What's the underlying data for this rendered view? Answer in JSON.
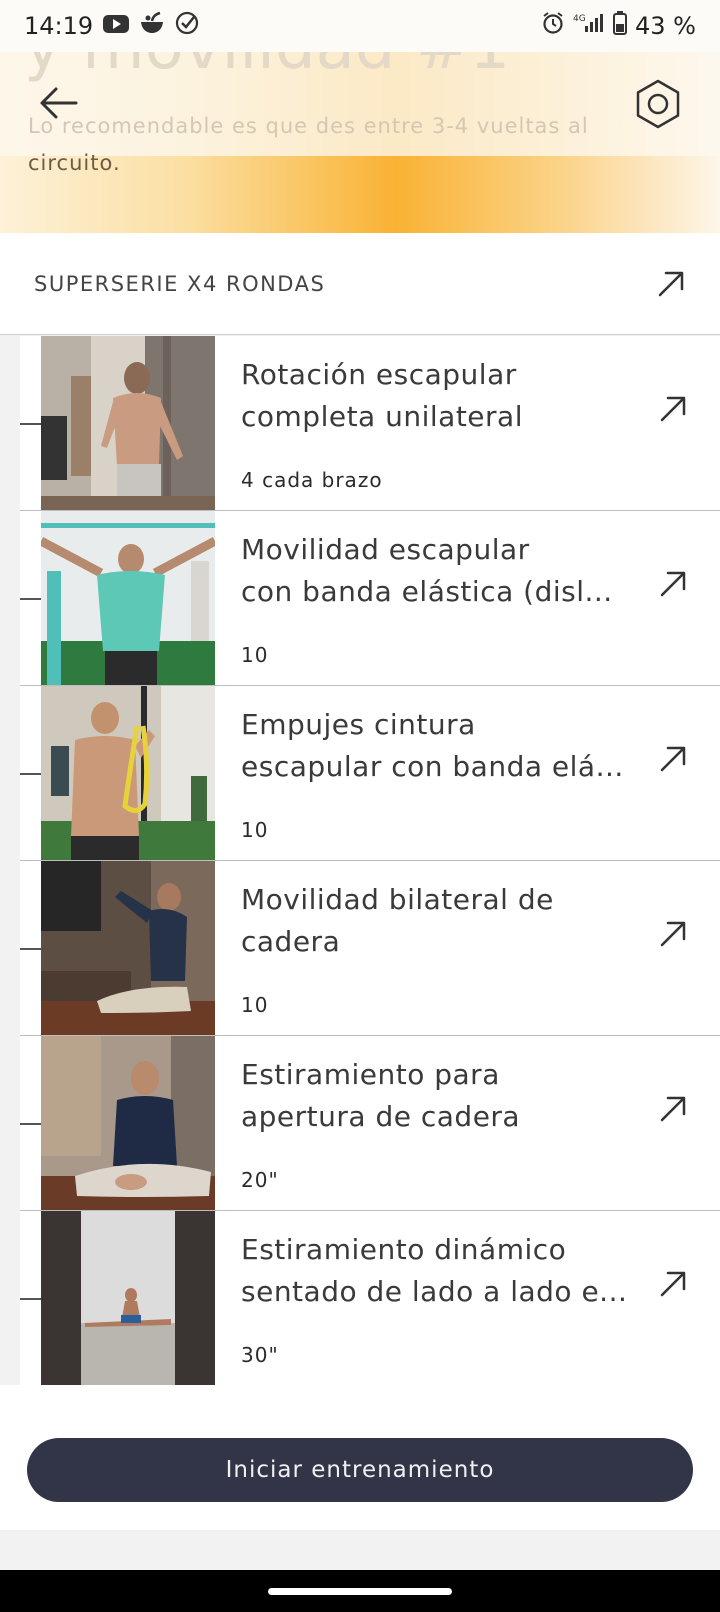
{
  "status_bar": {
    "time": "14:19",
    "battery": "43 %",
    "network": "4G",
    "left_icons": [
      "youtube-icon",
      "bowl-icon",
      "check-circle-icon"
    ],
    "right_icons": [
      "alarm-icon",
      "signal-icon",
      "battery-icon"
    ]
  },
  "header": {
    "title_fragment": "y movilidad #1",
    "description_line1": "Lo recomendable es que des entre 3-4 vueltas al",
    "description_line2": "circuito.",
    "gradient_colors": [
      "#fdf1d8",
      "#f9b233",
      "#fdf6ea"
    ]
  },
  "section": {
    "title": "SUPERSERIE X4 RONDAS"
  },
  "exercises": [
    {
      "name": "Rotación escapular completa unilateral",
      "reps": "4 cada brazo"
    },
    {
      "name_line1": "Movilidad escapular",
      "name_line2": "con banda elástica (disl...",
      "reps": "10"
    },
    {
      "name_line1": "Empujes cintura",
      "name_line2": "escapular con banda elá...",
      "reps": "10"
    },
    {
      "name": "Movilidad bilateral de cadera",
      "reps": "10"
    },
    {
      "name": "Estiramiento para apertura de cadera",
      "reps": "20\""
    },
    {
      "name_line1": "Estiramiento dinámico",
      "name_line2": "sentado de lado a lado e...",
      "reps": "30\""
    }
  ],
  "cta": {
    "label": "Iniciar entrenamiento",
    "color": "#323447"
  }
}
